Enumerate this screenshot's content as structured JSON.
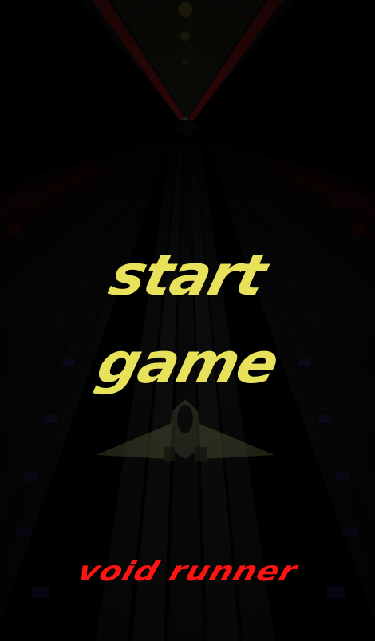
{
  "menu": {
    "start_line1": "start",
    "start_line2": "game"
  },
  "game": {
    "title": "void runner"
  },
  "colors": {
    "menu_text": "#e8e25a",
    "title_text": "#ff1414",
    "background": "#000000"
  },
  "icons": {
    "player_ship": "ship-icon"
  }
}
